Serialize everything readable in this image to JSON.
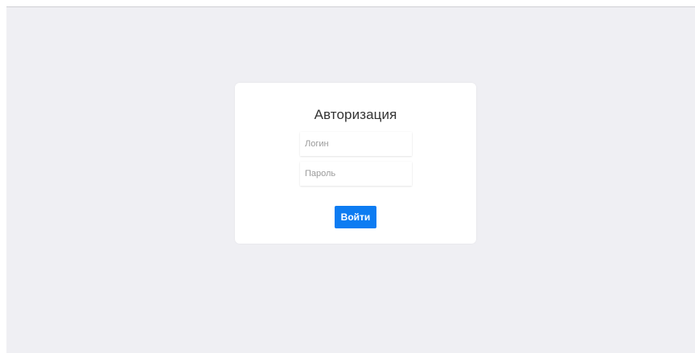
{
  "login_form": {
    "title": "Авторизация",
    "login_placeholder": "Логин",
    "login_value": "",
    "password_placeholder": "Пароль",
    "password_value": "",
    "submit_label": "Войти"
  },
  "colors": {
    "page_background": "#efeff3",
    "card_background": "#ffffff",
    "accent_button": "#0d7cf2"
  }
}
